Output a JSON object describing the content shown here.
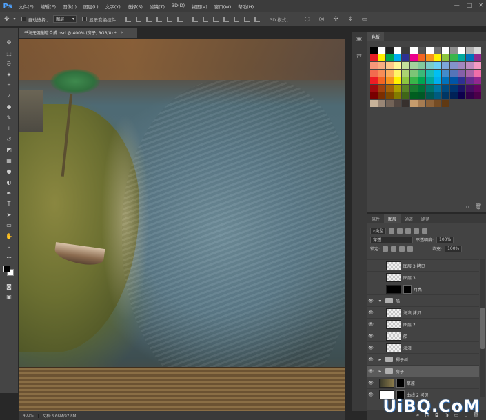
{
  "app": {
    "logo": "Ps"
  },
  "menu": [
    "文件(F)",
    "编辑(E)",
    "图像(I)",
    "图层(L)",
    "文字(Y)",
    "选择(S)",
    "滤镜(T)",
    "3D(D)",
    "视图(V)",
    "窗口(W)",
    "帮助(H)"
  ],
  "window_controls": [
    "—",
    "□",
    "✕"
  ],
  "options": {
    "auto_select_label": "自动选择：",
    "auto_select_value": "图层",
    "show_transform_label": "显示变换控件",
    "mode_3d": "3D 模式："
  },
  "document": {
    "tab_title": "书海无涯创意合成.psd @ 400% (房子, RGB/8) *",
    "zoom": "400%",
    "doc_info": "文档:3.66M/97.8M"
  },
  "swatches": {
    "tab_label": "色板",
    "colors": [
      "#000000",
      "#ffffff",
      "#1f1f1f",
      "#ffffff",
      "#3a3a3a",
      "#ffffff",
      "#555555",
      "#ffffff",
      "#6f6f6f",
      "#ffffff",
      "#8f8f8f",
      "#ffffff",
      "#b0b0b0",
      "#d8d8d8",
      "#e61e25",
      "#ffef00",
      "#00a650",
      "#00aeef",
      "#2e3192",
      "#ec008c",
      "#f26522",
      "#f7941d",
      "#fff200",
      "#8dc63f",
      "#39b54a",
      "#00a99d",
      "#0072bc",
      "#92278f",
      "#f7977a",
      "#f9ad81",
      "#fdc689",
      "#fff79a",
      "#c4df9b",
      "#a3d39c",
      "#82ca9c",
      "#7accc8",
      "#6dcff6",
      "#7da7d9",
      "#8393ca",
      "#a187be",
      "#bd8cbf",
      "#f49ac2",
      "#f26c4f",
      "#f68e56",
      "#fbaf5d",
      "#fff568",
      "#acd372",
      "#7cc576",
      "#3bb878",
      "#1abbb4",
      "#00bff3",
      "#438ccb",
      "#5574b9",
      "#8560a8",
      "#a864a8",
      "#f06ea9",
      "#ed1c24",
      "#f26522",
      "#f7941d",
      "#fff200",
      "#8dc63f",
      "#39b54a",
      "#00a651",
      "#00a99d",
      "#00aeef",
      "#0072bc",
      "#0054a6",
      "#2e3192",
      "#662d91",
      "#92278f",
      "#9e0b0f",
      "#a0410d",
      "#a3620a",
      "#aba000",
      "#598527",
      "#197b30",
      "#007236",
      "#00746b",
      "#0076a3",
      "#004b80",
      "#003471",
      "#1b1464",
      "#440e62",
      "#630460",
      "#790000",
      "#7b2e00",
      "#7d4900",
      "#827b00",
      "#406618",
      "#005e20",
      "#005826",
      "#005952",
      "#005b7f",
      "#003663",
      "#002157",
      "#0d004c",
      "#32004b",
      "#4b0049",
      "#c7b299",
      "#998675",
      "#736357",
      "#534741",
      "#37302d",
      "#c69c6d",
      "#a67c52",
      "#8c6239",
      "#754c24",
      "#603913"
    ]
  },
  "layers": {
    "tabs": [
      "属性",
      "图层",
      "通道",
      "路径"
    ],
    "active_tab": "图层",
    "kind_filter": "类型",
    "blend_mode": "穿透",
    "opacity_label": "不透明度:",
    "opacity_value": "100%",
    "lock_label": "锁定:",
    "fill_label": "填充:",
    "fill_value": "100%",
    "items": [
      {
        "name": "图层 3 拷贝",
        "visible": false,
        "indent": 1,
        "thumb": "checker"
      },
      {
        "name": "图层 3",
        "visible": false,
        "indent": 1,
        "thumb": "checker"
      },
      {
        "name": "月亮",
        "visible": false,
        "indent": 1,
        "thumb": "black",
        "adjust": true
      },
      {
        "name": "船",
        "visible": true,
        "indent": 0,
        "folder": true,
        "open": true
      },
      {
        "name": "海浪 拷贝",
        "visible": true,
        "indent": 1,
        "thumb": "checker"
      },
      {
        "name": "图层 2",
        "visible": true,
        "indent": 1,
        "thumb": "checker"
      },
      {
        "name": "船",
        "visible": true,
        "indent": 1,
        "thumb": "checker"
      },
      {
        "name": "海浪",
        "visible": true,
        "indent": 1,
        "thumb": "checker"
      },
      {
        "name": "椰子树",
        "visible": true,
        "indent": 0,
        "folder": true,
        "open": false
      },
      {
        "name": "房子",
        "visible": true,
        "indent": 0,
        "folder": true,
        "open": false,
        "selected": true
      },
      {
        "name": "草原",
        "visible": true,
        "indent": 0,
        "thumb": "dark",
        "mask": true
      },
      {
        "name": "曲线 2 拷贝",
        "visible": true,
        "indent": 0,
        "thumb": "white",
        "adjust": true
      }
    ]
  },
  "watermark": "UiBQ.CoM"
}
